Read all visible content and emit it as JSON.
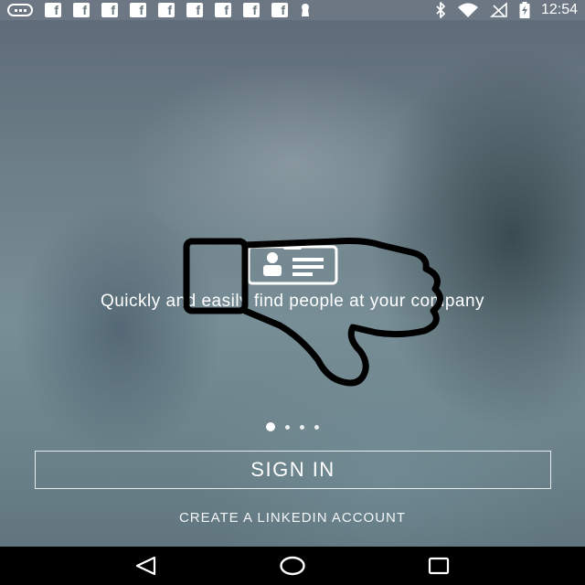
{
  "status_bar": {
    "notification_icons": [
      "keyboard-icon",
      "facebook-icon",
      "facebook-icon",
      "facebook-icon",
      "facebook-icon",
      "facebook-icon",
      "facebook-icon",
      "facebook-icon",
      "facebook-icon",
      "facebook-icon",
      "keyhole-icon"
    ],
    "facebook_glyph": "f",
    "system_icons": [
      "bluetooth-icon",
      "wifi-icon",
      "no-signal-icon",
      "battery-charging-icon"
    ],
    "time": "12:54"
  },
  "onboarding": {
    "feature_icon": "id-card-icon",
    "tagline": "Quickly and easily find people at your company",
    "overlay_icon": "thumbs-down-icon",
    "page_count": 4,
    "active_page": 1
  },
  "actions": {
    "sign_in_label": "SIGN IN",
    "create_account_label": "CREATE A LINKEDIN ACCOUNT"
  },
  "nav_bar": {
    "buttons": [
      "back-icon",
      "home-icon",
      "recents-icon"
    ]
  },
  "colors": {
    "text": "#ffffff",
    "nav_bar": "#000000"
  }
}
